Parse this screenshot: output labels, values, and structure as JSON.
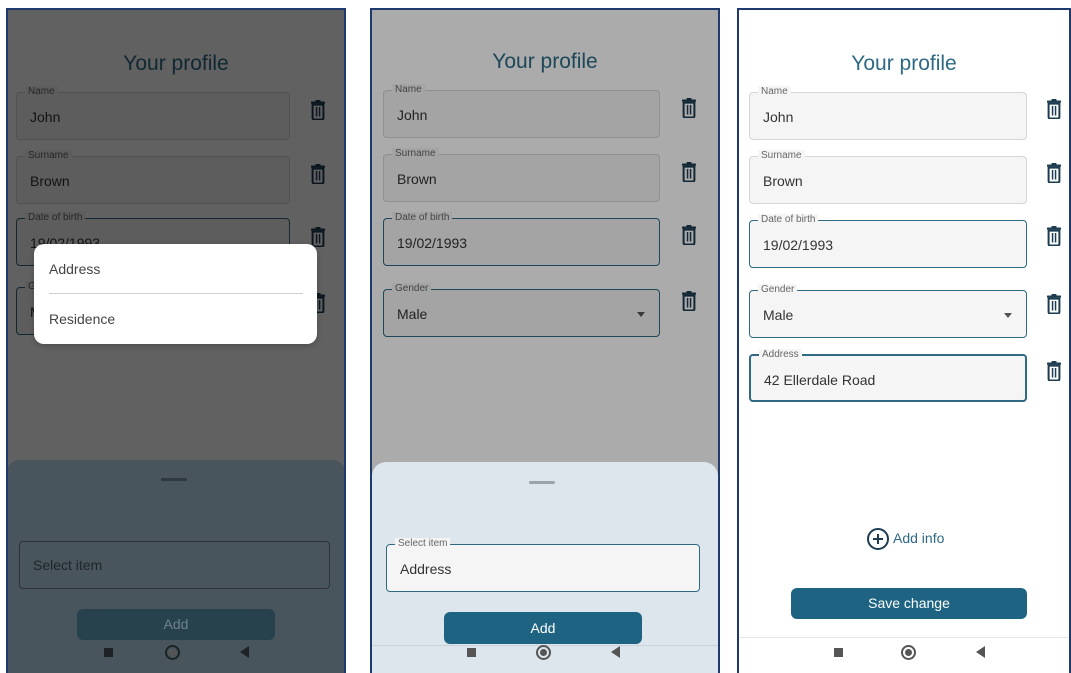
{
  "screen_title": "Your profile",
  "profile_fields": {
    "name": {
      "label": "Name",
      "value": "John"
    },
    "surname": {
      "label": "Surname",
      "value": "Brown"
    },
    "dob": {
      "label": "Date of birth",
      "value": "19/02/1993"
    },
    "gender": {
      "label": "Gender",
      "value": "Male"
    },
    "address": {
      "label": "Address",
      "value": "42 Ellerdale Road"
    }
  },
  "dialog": {
    "options": [
      "Address",
      "Residence"
    ]
  },
  "sheet_step1": {
    "placeholder": "Select item",
    "add_label": "Add"
  },
  "sheet_step2": {
    "field_label": "Select item",
    "field_value": "Address",
    "add_label": "Add"
  },
  "screen3": {
    "add_info_label": "Add info",
    "save_label": "Save change"
  },
  "icons": {
    "delete": "trash-icon",
    "add": "plus-circle-icon",
    "nav": [
      "nav-recents-icon",
      "nav-home-icon",
      "nav-back-icon"
    ]
  },
  "colors": {
    "accent": "#2e6a84",
    "primary_button": "#1e6482",
    "sheet_bg": "#dde6ec",
    "scrim": "rgba(0,0,0,0.62)"
  }
}
